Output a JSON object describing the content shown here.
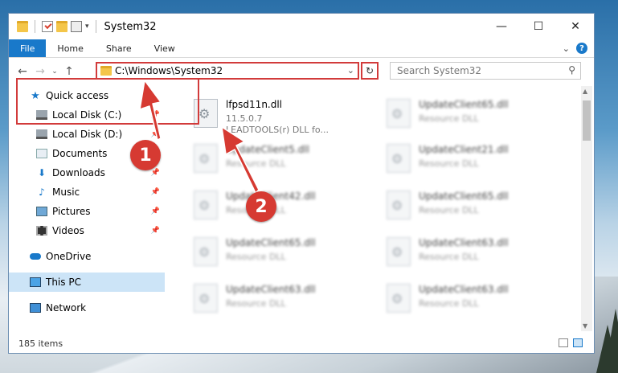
{
  "window": {
    "title": "System32",
    "controls": {
      "minimize": "—",
      "maximize": "☐",
      "close": "✕"
    }
  },
  "ribbon": {
    "tabs": [
      "File",
      "Home",
      "Share",
      "View"
    ]
  },
  "address": {
    "path": "C:\\Windows\\System32"
  },
  "search": {
    "placeholder": "Search System32"
  },
  "sidebar": {
    "items": [
      {
        "label": "Quick access",
        "icon": "star-icon"
      },
      {
        "label": "Local Disk (C:)",
        "icon": "drive-icon",
        "pinned": true
      },
      {
        "label": "Local Disk (D:)",
        "icon": "drive-icon",
        "pinned": true
      },
      {
        "label": "Documents",
        "icon": "documents-icon",
        "pinned": true
      },
      {
        "label": "Downloads",
        "icon": "downloads-icon",
        "pinned": true
      },
      {
        "label": "Music",
        "icon": "music-icon",
        "pinned": true
      },
      {
        "label": "Pictures",
        "icon": "pictures-icon",
        "pinned": true
      },
      {
        "label": "Videos",
        "icon": "videos-icon",
        "pinned": true
      },
      {
        "label": "OneDrive",
        "icon": "onedrive-icon"
      },
      {
        "label": "This PC",
        "icon": "this-pc-icon",
        "selected": true
      },
      {
        "label": "Network",
        "icon": "network-icon"
      }
    ]
  },
  "files": {
    "highlighted": {
      "name": "lfpsd11n.dll",
      "version": "11.5.0.7",
      "description": "LEADTOOLS(r) DLL fo..."
    },
    "blurred": [
      {
        "name": "UpdateClient65.dll",
        "type": "Resource DLL"
      },
      {
        "name": "UpdateClient5.dll",
        "type": "Resource DLL"
      },
      {
        "name": "UpdateClient21.dll",
        "type": "Resource DLL"
      },
      {
        "name": "UpdateClient42.dll",
        "type": "Resource DLL"
      },
      {
        "name": "UpdateClient65.dll",
        "type": "Resource DLL"
      },
      {
        "name": "UpdateClient65.dll",
        "type": "Resource DLL"
      },
      {
        "name": "UpdateClient63.dll",
        "type": "Resource DLL"
      },
      {
        "name": "UpdateClient63.dll",
        "type": "Resource DLL"
      },
      {
        "name": "UpdateClient63.dll",
        "type": "Resource DLL"
      }
    ]
  },
  "status": {
    "count": "185 items"
  },
  "annotations": {
    "marker1": "1",
    "marker2": "2"
  },
  "colors": {
    "accent": "#1979ca",
    "highlight": "#d23b3b"
  }
}
